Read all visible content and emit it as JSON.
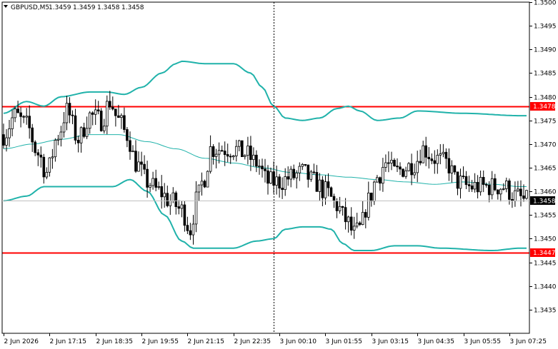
{
  "header": {
    "symbol": "GBPUSD,M5",
    "open": "1.3459",
    "high": "1.3459",
    "low": "1.3458",
    "close": "1.3458"
  },
  "colors": {
    "background": "#ffffff",
    "candle": "#000000",
    "bands": "#20b2aa",
    "moving_average": "#20b2aa",
    "support_resistance": "#ff0000",
    "label_text_on_red": "#ffffff",
    "current_price_box": "#000000"
  },
  "chart_data": {
    "type": "candlestick",
    "symbol": "GBPUSD",
    "timeframe": "M5",
    "y_axis": {
      "min": 1.343,
      "max": 1.35,
      "ticks": [
        "1.3500",
        "1.3495",
        "1.3490",
        "1.3485",
        "1.3480",
        "1.3475",
        "1.3470",
        "1.3465",
        "1.3460",
        "1.3455",
        "1.3450",
        "1.3445",
        "1.3440",
        "1.3435"
      ],
      "tick_values": [
        1.35,
        1.3495,
        1.349,
        1.3485,
        1.348,
        1.3475,
        1.347,
        1.3465,
        1.346,
        1.3455,
        1.345,
        1.3445,
        1.344,
        1.3435
      ]
    },
    "x_axis": {
      "labels": [
        "2 Jun 2026",
        "2 Jun 17:15",
        "2 Jun 18:35",
        "2 Jun 19:55",
        "2 Jun 21:15",
        "2 Jun 22:35",
        "3 Jun 00:10",
        "3 Jun 01:55",
        "3 Jun 03:15",
        "3 Jun 04:35",
        "3 Jun 05:55",
        "3 Jun 07:25"
      ],
      "label_index": [
        0,
        16,
        32,
        48,
        64,
        80,
        96,
        112,
        128,
        144,
        160,
        176
      ]
    },
    "candle_count": 183,
    "period_separator_index": 94,
    "horizontal_levels": [
      {
        "value": 1.3478,
        "label": "1.3478"
      },
      {
        "value": 1.3447,
        "label": "1.3447"
      }
    ],
    "current_price": {
      "value": 1.3458,
      "label": "1.3458"
    },
    "close_path": [
      [
        0,
        1.3472
      ],
      [
        4,
        1.3476
      ],
      [
        8,
        1.3474
      ],
      [
        12,
        1.3468
      ],
      [
        15,
        1.3464
      ],
      [
        19,
        1.3472
      ],
      [
        22,
        1.3477
      ],
      [
        26,
        1.3471
      ],
      [
        30,
        1.3476
      ],
      [
        34,
        1.3475
      ],
      [
        37,
        1.3479
      ],
      [
        40,
        1.3475
      ],
      [
        43,
        1.3472
      ],
      [
        46,
        1.3466
      ],
      [
        50,
        1.3462
      ],
      [
        54,
        1.346
      ],
      [
        58,
        1.3458
      ],
      [
        62,
        1.3456
      ],
      [
        65,
        1.3452
      ],
      [
        67,
        1.3458
      ],
      [
        70,
        1.3463
      ],
      [
        72,
        1.3469
      ],
      [
        76,
        1.3469
      ],
      [
        80,
        1.3469
      ],
      [
        84,
        1.3468
      ],
      [
        88,
        1.3466
      ],
      [
        92,
        1.3462
      ],
      [
        96,
        1.3462
      ],
      [
        100,
        1.3463
      ],
      [
        104,
        1.3464
      ],
      [
        108,
        1.3462
      ],
      [
        112,
        1.346
      ],
      [
        116,
        1.3457
      ],
      [
        119,
        1.3454
      ],
      [
        122,
        1.3451
      ],
      [
        124,
        1.3452
      ],
      [
        127,
        1.3458
      ],
      [
        130,
        1.3463
      ],
      [
        133,
        1.3466
      ],
      [
        136,
        1.3464
      ],
      [
        140,
        1.3465
      ],
      [
        143,
        1.3466
      ],
      [
        146,
        1.3469
      ],
      [
        150,
        1.3467
      ],
      [
        154,
        1.3466
      ],
      [
        158,
        1.3462
      ],
      [
        162,
        1.3461
      ],
      [
        166,
        1.3461
      ],
      [
        170,
        1.3461
      ],
      [
        174,
        1.3461
      ],
      [
        178,
        1.3459
      ],
      [
        182,
        1.3458
      ]
    ],
    "bands": {
      "upper": [
        [
          0,
          1.34765
        ],
        [
          8,
          1.3479
        ],
        [
          14,
          1.3478
        ],
        [
          20,
          1.348
        ],
        [
          30,
          1.3481
        ],
        [
          36,
          1.3481
        ],
        [
          42,
          1.34805
        ],
        [
          48,
          1.3482
        ],
        [
          55,
          1.3485
        ],
        [
          60,
          1.3487
        ],
        [
          62,
          1.34875
        ],
        [
          70,
          1.3487
        ],
        [
          80,
          1.3487
        ],
        [
          86,
          1.3485
        ],
        [
          90,
          1.3482
        ],
        [
          94,
          1.3478
        ],
        [
          98,
          1.34755
        ],
        [
          104,
          1.3475
        ],
        [
          110,
          1.34755
        ],
        [
          116,
          1.34775
        ],
        [
          120,
          1.3478
        ],
        [
          124,
          1.3477
        ],
        [
          130,
          1.3475
        ],
        [
          138,
          1.34755
        ],
        [
          144,
          1.3477
        ],
        [
          160,
          1.34765
        ],
        [
          180,
          1.3476
        ]
      ],
      "middle": [
        [
          0,
          1.3469
        ],
        [
          10,
          1.347
        ],
        [
          20,
          1.3471
        ],
        [
          30,
          1.3472
        ],
        [
          40,
          1.3472
        ],
        [
          50,
          1.34705
        ],
        [
          60,
          1.3469
        ],
        [
          70,
          1.3467
        ],
        [
          80,
          1.3466
        ],
        [
          90,
          1.3465
        ],
        [
          100,
          1.3464
        ],
        [
          110,
          1.34635
        ],
        [
          120,
          1.3463
        ],
        [
          130,
          1.34625
        ],
        [
          140,
          1.3462
        ],
        [
          150,
          1.34615
        ],
        [
          160,
          1.3462
        ],
        [
          170,
          1.34615
        ],
        [
          180,
          1.3461
        ]
      ],
      "lower": [
        [
          0,
          1.3458
        ],
        [
          8,
          1.3459
        ],
        [
          14,
          1.3461
        ],
        [
          22,
          1.3461
        ],
        [
          32,
          1.3461
        ],
        [
          38,
          1.3461
        ],
        [
          44,
          1.34625
        ],
        [
          50,
          1.346
        ],
        [
          56,
          1.3455
        ],
        [
          62,
          1.34495
        ],
        [
          66,
          1.3448
        ],
        [
          72,
          1.3448
        ],
        [
          80,
          1.3448
        ],
        [
          88,
          1.34495
        ],
        [
          94,
          1.345
        ],
        [
          98,
          1.3452
        ],
        [
          104,
          1.34525
        ],
        [
          110,
          1.34525
        ],
        [
          114,
          1.3452
        ],
        [
          118,
          1.3449
        ],
        [
          122,
          1.34475
        ],
        [
          128,
          1.34475
        ],
        [
          136,
          1.34485
        ],
        [
          144,
          1.34485
        ],
        [
          152,
          1.3448
        ],
        [
          170,
          1.34475
        ],
        [
          180,
          1.3448
        ]
      ]
    }
  }
}
